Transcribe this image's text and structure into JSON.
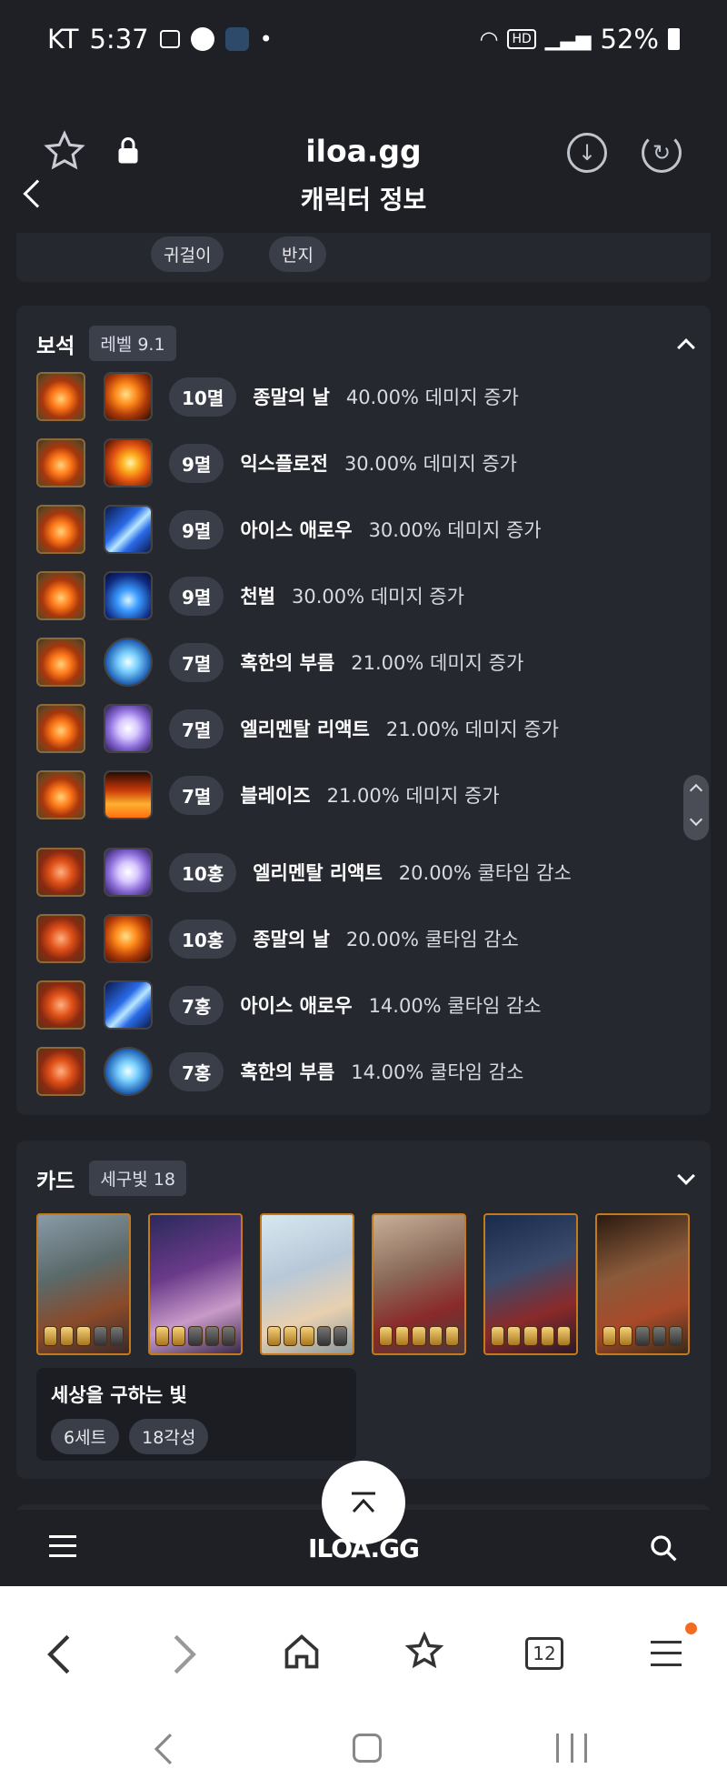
{
  "status": {
    "carrier": "KT",
    "time": "5:37",
    "battery": "52%"
  },
  "browser": {
    "url": "iloa.gg"
  },
  "page": {
    "title": "캐릭터 정보"
  },
  "accessory_chips": [
    "귀걸이",
    "반지"
  ],
  "gems": {
    "title": "보석",
    "level_tag": "레벨 9.1",
    "rows": [
      {
        "level": "10멸",
        "skill": "종말의 날",
        "effect": "40.00% 데미지 증가",
        "skill_icon": "fire-meteor-icon",
        "gem_type": "damage"
      },
      {
        "level": "9멸",
        "skill": "익스플로전",
        "effect": "30.00% 데미지 증가",
        "skill_icon": "explosion-icon",
        "gem_type": "damage"
      },
      {
        "level": "9멸",
        "skill": "아이스 애로우",
        "effect": "30.00% 데미지 증가",
        "skill_icon": "ice-arrow-icon",
        "gem_type": "damage"
      },
      {
        "level": "9멸",
        "skill": "천벌",
        "effect": "30.00% 데미지 증가",
        "skill_icon": "thunder-icon",
        "gem_type": "damage"
      },
      {
        "level": "7멸",
        "skill": "혹한의 부름",
        "effect": "21.00% 데미지 증가",
        "skill_icon": "frost-icon",
        "gem_type": "damage"
      },
      {
        "level": "7멸",
        "skill": "엘리멘탈 리액트",
        "effect": "21.00% 데미지 증가",
        "skill_icon": "elemental-icon",
        "gem_type": "damage"
      },
      {
        "level": "7멸",
        "skill": "블레이즈",
        "effect": "21.00% 데미지 증가",
        "skill_icon": "blaze-icon",
        "gem_type": "damage"
      },
      {
        "level": "10홍",
        "skill": "엘리멘탈 리액트",
        "effect": "20.00% 쿨타임 감소",
        "skill_icon": "elemental-icon",
        "gem_type": "cooldown"
      },
      {
        "level": "10홍",
        "skill": "종말의 날",
        "effect": "20.00% 쿨타임 감소",
        "skill_icon": "fire-meteor-icon",
        "gem_type": "cooldown"
      },
      {
        "level": "7홍",
        "skill": "아이스 애로우",
        "effect": "14.00% 쿨타임 감소",
        "skill_icon": "ice-arrow-icon",
        "gem_type": "cooldown"
      },
      {
        "level": "7홍",
        "skill": "혹한의 부름",
        "effect": "14.00% 쿨타임 감소",
        "skill_icon": "frost-icon",
        "gem_type": "cooldown"
      }
    ]
  },
  "cards": {
    "title": "카드",
    "tag": "세구빛 18",
    "items": [
      {
        "awakening": 3,
        "max": 5
      },
      {
        "awakening": 2,
        "max": 5
      },
      {
        "awakening": 3,
        "max": 5
      },
      {
        "awakening": 5,
        "max": 5
      },
      {
        "awakening": 5,
        "max": 5
      },
      {
        "awakening": 2,
        "max": 5
      }
    ],
    "set_name": "세상을 구하는 빛",
    "set_chips": [
      "6세트",
      "18각성"
    ]
  },
  "site_footer": {
    "logo": "ILOA.GG"
  },
  "colors": {
    "background": "#1e2026",
    "panel": "#25282f",
    "card_border": "#c47a1a",
    "notification_dot": "#f26b21"
  }
}
